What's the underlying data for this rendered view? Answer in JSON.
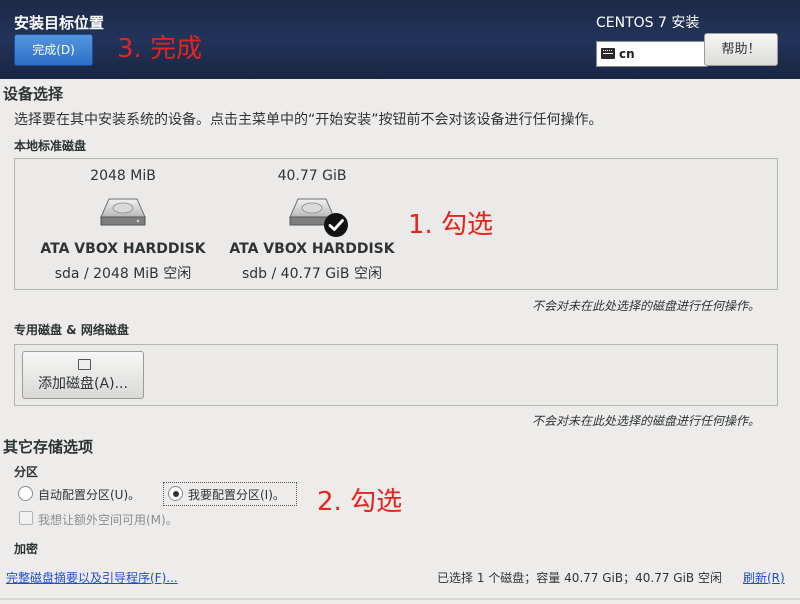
{
  "header": {
    "title": "安装目标位置",
    "done_label": "完成(D)",
    "product": "CENTOS 7 安装",
    "keyboard_layout": "cn",
    "help_label": "帮助！"
  },
  "annotations": {
    "step3": "3. 完成",
    "step1": "1. 勾选",
    "step2": "2. 勾选",
    "color": "#e8221c"
  },
  "device_selection": {
    "title": "设备选择",
    "instruction": "选择要在其中安装系统的设备。点击主菜单中的“开始安装”按钮前不会对该设备进行任何操作。",
    "local_disks_label": "本地标准磁盘",
    "disks": [
      {
        "size": "2048 MiB",
        "model": "ATA VBOX HARDDISK",
        "info": "sda  /  2048 MiB 空闲",
        "selected": false
      },
      {
        "size": "40.77 GiB",
        "model": "ATA VBOX HARDDISK",
        "info": "sdb  /  40.77 GiB 空闲",
        "selected": true
      }
    ],
    "local_note": "不会对未在此处选择的磁盘进行任何操作。",
    "specialized_label": "专用磁盘 & 网络磁盘",
    "add_disk_label": "添加磁盘(A)...",
    "specialized_note": "不会对未在此处选择的磁盘进行任何操作。"
  },
  "other_options": {
    "title": "其它存储选项",
    "partition_label": "分区",
    "auto_partition": "自动配置分区(U)。",
    "manual_partition": "我要配置分区(I)。",
    "selected_partition": "manual",
    "extra_space": "我想让额外空间可用(M)。",
    "encryption_label": "加密"
  },
  "footer": {
    "summary_link": "完整磁盘摘要以及引导程序(F)...",
    "status": "已选择 1 个磁盘；容量 40.77 GiB；40.77 GiB 空闲",
    "refresh": "刷新(R)"
  }
}
